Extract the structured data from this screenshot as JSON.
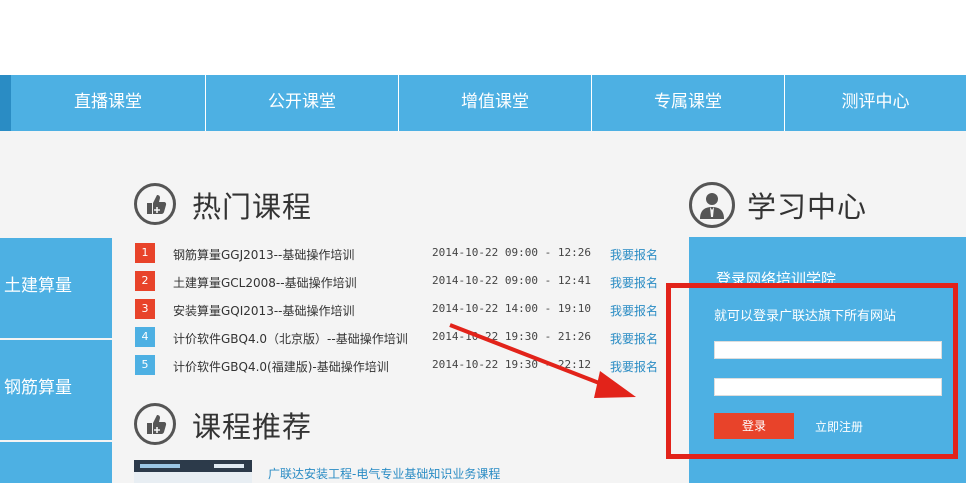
{
  "nav": {
    "items": [
      {
        "label": "直播课堂"
      },
      {
        "label": "公开课堂"
      },
      {
        "label": "增值课堂"
      },
      {
        "label": "专属课堂"
      },
      {
        "label": "测评中心"
      }
    ]
  },
  "sidebar": {
    "items": [
      {
        "label": "土建算量"
      },
      {
        "label": "钢筋算量"
      }
    ]
  },
  "hot": {
    "title": "热门课程",
    "courses": [
      {
        "rank": "1",
        "name": "钢筋算量GGJ2013--基础操作培训",
        "time": "2014-10-22 09:00 - 12:26",
        "action": "我要报名",
        "rank_color": "#e8432a"
      },
      {
        "rank": "2",
        "name": "土建算量GCL2008--基础操作培训",
        "time": "2014-10-22 09:00 - 12:41",
        "action": "我要报名",
        "rank_color": "#e8432a"
      },
      {
        "rank": "3",
        "name": "安装算量GQI2013--基础操作培训",
        "time": "2014-10-22 14:00 - 19:10",
        "action": "我要报名",
        "rank_color": "#e8432a"
      },
      {
        "rank": "4",
        "name": "计价软件GBQ4.0（北京版）--基础操作培训",
        "time": "2014-10-22 19:30 - 21:26",
        "action": "我要报名",
        "rank_color": "#4db0e3"
      },
      {
        "rank": "5",
        "name": "计价软件GBQ4.0(福建版)-基础操作培训",
        "time": "2014-10-22 19:30 - 22:12",
        "action": "我要报名",
        "rank_color": "#4db0e3"
      }
    ]
  },
  "recommend": {
    "title": "课程推荐",
    "items": [
      {
        "name": "广联达安装工程-电气专业基础知识业务课程"
      }
    ]
  },
  "study": {
    "title": "学习中心",
    "subtitle": "登录网络培训学院",
    "hint": "就可以登录广联达旗下所有网站",
    "login_label": "登录",
    "register_label": "立即注册",
    "username_value": "",
    "password_value": ""
  },
  "colors": {
    "accent": "#4db0e3",
    "highlight": "#e2231a",
    "button": "#e8432a"
  }
}
